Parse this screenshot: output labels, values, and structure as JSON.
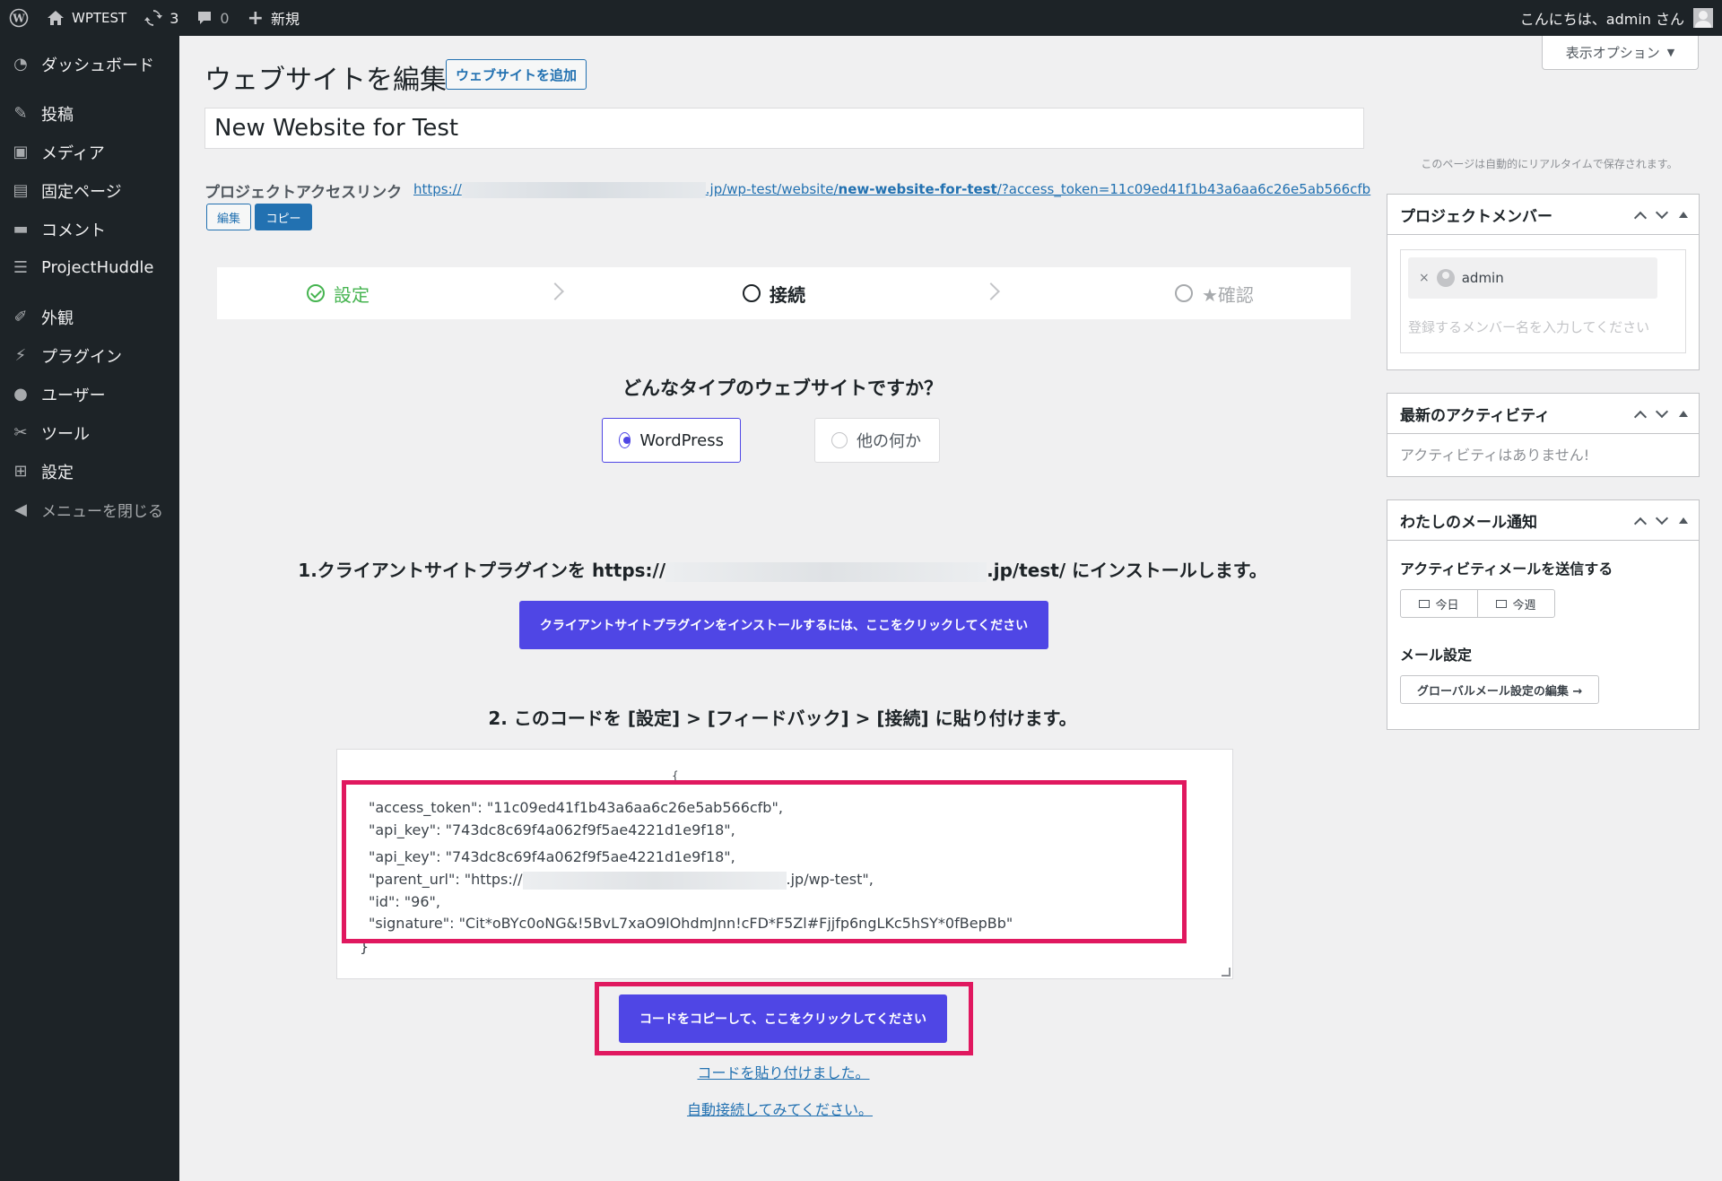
{
  "adminbar": {
    "site_name": "WPTEST",
    "updates_count": "3",
    "comments_count": "0",
    "new_label": "新規",
    "greeting": "こんにちは、admin さん"
  },
  "sidebar": {
    "items": [
      {
        "label": "ダッシュボード",
        "icon": "dashboard-icon"
      },
      {
        "label": "投稿",
        "icon": "pin-icon"
      },
      {
        "label": "メディア",
        "icon": "media-icon"
      },
      {
        "label": "固定ページ",
        "icon": "page-icon"
      },
      {
        "label": "コメント",
        "icon": "comment-icon"
      },
      {
        "label": "ProjectHuddle",
        "icon": "feedback-icon"
      },
      {
        "label": "外観",
        "icon": "brush-icon"
      },
      {
        "label": "プラグイン",
        "icon": "plugin-icon"
      },
      {
        "label": "ユーザー",
        "icon": "user-icon"
      },
      {
        "label": "ツール",
        "icon": "wrench-icon"
      },
      {
        "label": "設定",
        "icon": "settings-icon"
      }
    ],
    "collapse_label": "メニューを閉じる"
  },
  "header": {
    "title": "ウェブサイトを編集",
    "add_new_label": "ウェブサイトを追加",
    "screen_options_label": "表示オプション"
  },
  "post_title": "New Website for Test",
  "access_link": {
    "label": "プロジェクトアクセスリンク",
    "url_prefix": "https://",
    "url_mid": ".jp/wp-test/website/",
    "url_slug": "new-website-for-test",
    "url_suffix": "/?access_token=11c09ed41f1b43a6aa6c26e5ab566cfb",
    "edit_label": "編集",
    "copy_label": "コピー"
  },
  "steps": [
    {
      "label": "設定",
      "state": "done"
    },
    {
      "label": "接続",
      "state": "current"
    },
    {
      "label": "★確認",
      "state": "todo"
    }
  ],
  "site_type": {
    "question": "どんなタイプのウェブサイトですか？",
    "option_wordpress": "WordPress",
    "option_other": "他の何か",
    "selected": "WordPress"
  },
  "install": {
    "text_before": "1.クライアントサイトプラグインを https://",
    "text_after": ".jp/test/ にインストールします。",
    "button_label": "クライアントサイトプラグインをインストールするには、ここをクリックしてください"
  },
  "paste": {
    "instruction": "2. このコードを [設定] > [フィードバック] > [接続] に貼り付けます。",
    "open_brace": "{",
    "close_brace": "}",
    "lines": [
      "\"access_token\": \"11c09ed41f1b43a6aa6c26e5ab566cfb\",",
      "\"api_key\": \"743dc8c69f4a062f9f5ae4221d1e9f18\",",
      "\"api_key\": \"743dc8c69f4a062f9f5ae4221d1e9f18\","
    ],
    "parent_url_prefix": "\"parent_url\": \"https://",
    "parent_url_suffix": ".jp/wp-test\",",
    "id_line": "\"id\": \"96\",",
    "signature_line": "\"signature\": \"Cit*oBYc0oNG&!5BvL7xaO9lOhdmJnn!cFD*F5Zl#Fjjfp6ngLKc5hSY*0fBepBb\"",
    "copy_button_label": "コードをコピーして、ここをクリックしてください",
    "pasted_link": "コードを貼り付けました。",
    "auto_connect_link": "自動接続してみてください。"
  },
  "right": {
    "autosave_note": "このページは自動的にリアルタイムで保存されます。",
    "members": {
      "title": "プロジェクトメンバー",
      "member_name": "admin",
      "placeholder": "登録するメンバー名を入力してください"
    },
    "activity": {
      "title": "最新のアクティビティ",
      "empty_text": "アクティビティはありません!"
    },
    "mail": {
      "title": "わたしのメール通知",
      "send_label": "アクティビティメールを送信する",
      "today_label": "今日",
      "week_label": "今週",
      "settings_label": "メール設定",
      "global_button_label": "グローバルメール設定の編集 →"
    }
  },
  "colors": {
    "accent": "#4f46e5",
    "highlight": "#e0185f",
    "link": "#2271b1",
    "success": "#46b450"
  }
}
